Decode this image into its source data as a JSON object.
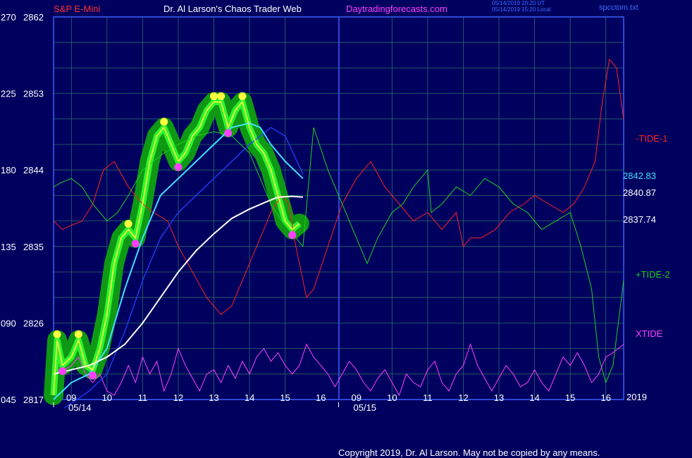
{
  "header": {
    "instrument": "S&P E-Mini",
    "site": "Dr. Al Larson's Chaos Trader Web",
    "url": "Daytradingforecasts.com",
    "stamp_ut": "05/14/2019 20:20 UT",
    "stamp_local": "05/14/2019 15:20 Local",
    "file": "spcctom.txt"
  },
  "footer": {
    "copyright": "Copyright 2019, Dr. Al Larson. May not be copied by any means."
  },
  "colors": {
    "background": "#00005f",
    "grid": "#2a6a6a",
    "frame": "#3a5fff",
    "tide1": "#ff2020",
    "tide2": "#20d020",
    "xtide": "#ff40ff",
    "price": "#ffff40",
    "band": "#10a010",
    "ema_fast": "#40e0ff",
    "ema_mid": "#2040ff",
    "ema_slow": "#ffffff"
  },
  "chart_data": {
    "type": "line",
    "title": "S&P E-Mini",
    "ylim": [
      2817,
      2862
    ],
    "y_ticks_price": [
      "2862",
      "2853",
      "2844",
      "2835",
      "2826",
      "2817"
    ],
    "y_ticks_index": [
      "270",
      "225",
      "180",
      "135",
      "090",
      "045"
    ],
    "x_ticks": [
      "09",
      "10",
      "11",
      "12",
      "13",
      "14",
      "15",
      "16",
      "09",
      "10",
      "11",
      "12",
      "13",
      "14",
      "15",
      "16"
    ],
    "x_range_hours": [
      8.5,
      24.5
    ],
    "dates": [
      {
        "label": "05/14",
        "x": 8.5
      },
      {
        "label": "05/15",
        "x": 16.5
      }
    ],
    "year_label": "2019",
    "right_labels": [
      {
        "text": "-TIDE-1",
        "series": "tide1"
      },
      {
        "text": "2842.83",
        "series": "ema_fast"
      },
      {
        "text": "2840.87",
        "series": "ema_slow"
      },
      {
        "text": "2837.74",
        "series": "price"
      },
      {
        "text": "+TIDE-2",
        "series": "tide2"
      },
      {
        "text": "XTIDE",
        "series": "xtide"
      }
    ],
    "series": {
      "price": [
        [
          8.5,
          2817.5
        ],
        [
          8.6,
          2824
        ],
        [
          8.75,
          2821
        ],
        [
          9.0,
          2822
        ],
        [
          9.2,
          2824
        ],
        [
          9.4,
          2821
        ],
        [
          9.6,
          2820.5
        ],
        [
          9.8,
          2823
        ],
        [
          10.0,
          2827
        ],
        [
          10.2,
          2833
        ],
        [
          10.4,
          2836
        ],
        [
          10.6,
          2837
        ],
        [
          10.8,
          2836
        ],
        [
          11.0,
          2840
        ],
        [
          11.2,
          2845
        ],
        [
          11.4,
          2848
        ],
        [
          11.6,
          2849
        ],
        [
          11.8,
          2847
        ],
        [
          12.0,
          2845
        ],
        [
          12.2,
          2846
        ],
        [
          12.4,
          2848
        ],
        [
          12.6,
          2849
        ],
        [
          12.8,
          2851
        ],
        [
          13.0,
          2852
        ],
        [
          13.2,
          2852
        ],
        [
          13.4,
          2849
        ],
        [
          13.6,
          2851
        ],
        [
          13.8,
          2852
        ],
        [
          14.0,
          2849
        ],
        [
          14.2,
          2847
        ],
        [
          14.4,
          2846
        ],
        [
          14.6,
          2844
        ],
        [
          14.8,
          2841
        ],
        [
          15.0,
          2838
        ],
        [
          15.2,
          2837
        ],
        [
          15.4,
          2837.7
        ]
      ],
      "ema_fast": [
        [
          8.5,
          2817
        ],
        [
          9.0,
          2819
        ],
        [
          9.5,
          2820
        ],
        [
          10.0,
          2823
        ],
        [
          10.5,
          2830
        ],
        [
          11.0,
          2836
        ],
        [
          11.5,
          2841
        ],
        [
          12.0,
          2843
        ],
        [
          12.5,
          2845
        ],
        [
          13.0,
          2847
        ],
        [
          13.5,
          2849
        ],
        [
          14.0,
          2849.5
        ],
        [
          14.3,
          2849
        ],
        [
          14.6,
          2847
        ],
        [
          15.0,
          2845
        ],
        [
          15.5,
          2843
        ]
      ],
      "ema_mid": [
        [
          8.8,
          2816
        ],
        [
          9.5,
          2818
        ],
        [
          10.0,
          2820
        ],
        [
          10.5,
          2825
        ],
        [
          11.0,
          2831
        ],
        [
          11.5,
          2836
        ],
        [
          12.0,
          2839
        ],
        [
          12.5,
          2841
        ],
        [
          13.0,
          2843
        ],
        [
          13.5,
          2845
        ],
        [
          14.0,
          2847
        ],
        [
          14.3,
          2848
        ],
        [
          14.6,
          2849
        ],
        [
          15.0,
          2848
        ],
        [
          15.5,
          2843.5
        ]
      ],
      "ema_slow": [
        [
          8.5,
          2820
        ],
        [
          9.0,
          2820.5
        ],
        [
          9.5,
          2821
        ],
        [
          10.0,
          2822
        ],
        [
          10.5,
          2823.5
        ],
        [
          11.0,
          2826
        ],
        [
          11.5,
          2829
        ],
        [
          12.0,
          2832
        ],
        [
          12.5,
          2834.5
        ],
        [
          13.0,
          2836.5
        ],
        [
          13.5,
          2838.3
        ],
        [
          14.0,
          2839.4
        ],
        [
          14.5,
          2840.3
        ],
        [
          14.8,
          2840.8
        ],
        [
          15.2,
          2840.9
        ],
        [
          15.5,
          2840.8
        ]
      ],
      "tide1": [
        [
          8.5,
          2838
        ],
        [
          8.75,
          2837
        ],
        [
          9.0,
          2837.5
        ],
        [
          9.3,
          2838
        ],
        [
          9.6,
          2840
        ],
        [
          9.9,
          2844
        ],
        [
          10.2,
          2845
        ],
        [
          10.6,
          2842
        ],
        [
          11.0,
          2840
        ],
        [
          11.3,
          2839
        ],
        [
          11.7,
          2838
        ],
        [
          12.0,
          2835
        ],
        [
          12.4,
          2832
        ],
        [
          12.8,
          2829
        ],
        [
          13.2,
          2827
        ],
        [
          13.5,
          2828
        ],
        [
          13.9,
          2832
        ],
        [
          14.3,
          2836
        ],
        [
          14.6,
          2839
        ],
        [
          14.9,
          2841
        ],
        [
          15.1,
          2840
        ],
        [
          15.3,
          2835
        ],
        [
          15.6,
          2829
        ],
        [
          15.8,
          2830
        ],
        [
          16.2,
          2835
        ],
        [
          16.6,
          2840
        ],
        [
          17.0,
          2843
        ],
        [
          17.4,
          2845
        ],
        [
          17.8,
          2842
        ],
        [
          18.2,
          2840
        ],
        [
          18.6,
          2838
        ],
        [
          19.0,
          2839
        ],
        [
          19.4,
          2837
        ],
        [
          19.8,
          2839
        ],
        [
          20.0,
          2835
        ],
        [
          20.2,
          2836
        ],
        [
          20.5,
          2836
        ],
        [
          20.9,
          2837
        ],
        [
          21.3,
          2839
        ],
        [
          21.7,
          2840
        ],
        [
          22.0,
          2841
        ],
        [
          22.4,
          2840
        ],
        [
          22.8,
          2839
        ],
        [
          23.1,
          2840
        ],
        [
          23.4,
          2842
        ],
        [
          23.7,
          2845
        ],
        [
          23.9,
          2852
        ],
        [
          24.1,
          2857
        ],
        [
          24.3,
          2856
        ],
        [
          24.5,
          2850
        ]
      ],
      "tide2": [
        [
          8.5,
          2842
        ],
        [
          8.7,
          2842.5
        ],
        [
          9.0,
          2843
        ],
        [
          9.3,
          2842
        ],
        [
          9.6,
          2840
        ],
        [
          10.0,
          2838
        ],
        [
          10.3,
          2839
        ],
        [
          10.6,
          2841
        ],
        [
          11.0,
          2844
        ],
        [
          11.3,
          2845
        ],
        [
          11.6,
          2846
        ],
        [
          12.0,
          2847
        ],
        [
          12.5,
          2848
        ],
        [
          13.0,
          2848.5
        ],
        [
          13.5,
          2848
        ],
        [
          14.0,
          2846
        ],
        [
          14.3,
          2843
        ],
        [
          14.6,
          2840
        ],
        [
          14.9,
          2838
        ],
        [
          15.1,
          2837
        ],
        [
          15.3,
          2836
        ],
        [
          15.5,
          2835
        ],
        [
          15.8,
          2849
        ],
        [
          16.2,
          2844
        ],
        [
          16.6,
          2840
        ],
        [
          17.0,
          2836
        ],
        [
          17.3,
          2833
        ],
        [
          17.6,
          2836
        ],
        [
          18.0,
          2839
        ],
        [
          18.3,
          2840
        ],
        [
          18.6,
          2842
        ],
        [
          19.0,
          2844
        ],
        [
          19.1,
          2839
        ],
        [
          19.4,
          2840
        ],
        [
          19.8,
          2842
        ],
        [
          20.2,
          2841
        ],
        [
          20.6,
          2843
        ],
        [
          21.0,
          2842
        ],
        [
          21.4,
          2840
        ],
        [
          21.8,
          2839
        ],
        [
          22.2,
          2837
        ],
        [
          22.6,
          2838
        ],
        [
          23.0,
          2839
        ],
        [
          23.3,
          2835
        ],
        [
          23.6,
          2830
        ],
        [
          23.8,
          2822
        ],
        [
          24.0,
          2819
        ],
        [
          24.2,
          2821
        ],
        [
          24.5,
          2831
        ]
      ],
      "xtide": [
        [
          8.5,
          2820
        ],
        [
          8.8,
          2820.5
        ],
        [
          9.0,
          2821
        ],
        [
          9.2,
          2822
        ],
        [
          9.4,
          2820
        ],
        [
          9.6,
          2819
        ],
        [
          9.8,
          2820
        ],
        [
          10.0,
          2818
        ],
        [
          10.2,
          2817.5
        ],
        [
          10.4,
          2819
        ],
        [
          10.6,
          2821
        ],
        [
          10.8,
          2819
        ],
        [
          11.0,
          2822
        ],
        [
          11.2,
          2820
        ],
        [
          11.4,
          2821.5
        ],
        [
          11.6,
          2818
        ],
        [
          11.8,
          2820
        ],
        [
          12.0,
          2823
        ],
        [
          12.2,
          2821
        ],
        [
          12.4,
          2819.5
        ],
        [
          12.6,
          2818
        ],
        [
          12.8,
          2820
        ],
        [
          13.0,
          2820.5
        ],
        [
          13.2,
          2819
        ],
        [
          13.4,
          2821
        ],
        [
          13.6,
          2819.5
        ],
        [
          13.8,
          2821.5
        ],
        [
          14.0,
          2820
        ],
        [
          14.2,
          2822
        ],
        [
          14.4,
          2823
        ],
        [
          14.6,
          2821.5
        ],
        [
          14.8,
          2822.5
        ],
        [
          15.0,
          2821
        ],
        [
          15.2,
          2820
        ],
        [
          15.4,
          2821
        ],
        [
          15.6,
          2823.5
        ],
        [
          15.8,
          2822
        ],
        [
          16.0,
          2821
        ],
        [
          16.2,
          2820
        ],
        [
          16.4,
          2818.5
        ],
        [
          16.6,
          2820
        ],
        [
          16.8,
          2821.5
        ],
        [
          17.0,
          2820.5
        ],
        [
          17.2,
          2819
        ],
        [
          17.4,
          2818
        ],
        [
          17.6,
          2819.5
        ],
        [
          17.8,
          2820.5
        ],
        [
          18.0,
          2819
        ],
        [
          18.2,
          2817.5
        ],
        [
          18.4,
          2820
        ],
        [
          18.6,
          2819
        ],
        [
          18.8,
          2818.5
        ],
        [
          19.0,
          2820.5
        ],
        [
          19.2,
          2821.5
        ],
        [
          19.4,
          2819
        ],
        [
          19.6,
          2818
        ],
        [
          19.8,
          2820
        ],
        [
          20.0,
          2821
        ],
        [
          20.2,
          2823.5
        ],
        [
          20.4,
          2821
        ],
        [
          20.6,
          2819.5
        ],
        [
          20.8,
          2818
        ],
        [
          21.0,
          2819.5
        ],
        [
          21.2,
          2821
        ],
        [
          21.4,
          2820
        ],
        [
          21.6,
          2818.5
        ],
        [
          21.8,
          2819
        ],
        [
          22.0,
          2820.5
        ],
        [
          22.2,
          2819
        ],
        [
          22.4,
          2818
        ],
        [
          22.6,
          2820
        ],
        [
          22.8,
          2822
        ],
        [
          23.0,
          2821
        ],
        [
          23.2,
          2822.5
        ],
        [
          23.4,
          2821
        ],
        [
          23.6,
          2819
        ],
        [
          23.8,
          2820
        ],
        [
          24.0,
          2822
        ],
        [
          24.2,
          2822.5
        ],
        [
          24.5,
          2823.5
        ]
      ]
    }
  }
}
